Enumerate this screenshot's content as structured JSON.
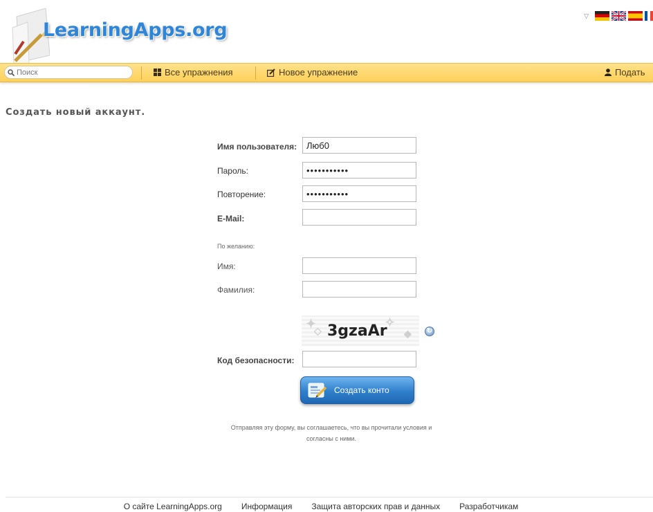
{
  "header": {
    "logo": "LearningApps.org",
    "languages": [
      "de",
      "en",
      "es",
      "fr"
    ]
  },
  "nav": {
    "search_placeholder": "Поиск",
    "all_exercises": "Все упражнения",
    "new_exercise": "Новое упражнение",
    "submit": "Подать"
  },
  "page": {
    "title": "Создать новый аккаунт."
  },
  "form": {
    "username_label": "Имя пользователя:",
    "username_value": "Люб0",
    "password_label": "Пароль:",
    "password_value": "•••••••••••",
    "repeat_label": "Повторение:",
    "repeat_value": "•••••••••••",
    "email_label": "E-Mail:",
    "email_value": "",
    "optional_label": "По желанию:",
    "first_name_label": "Имя:",
    "first_name_value": "",
    "last_name_label": "Фамилия:",
    "last_name_value": "",
    "captcha_text": "3gzaAr",
    "security_code_label": "Код безопасности:",
    "security_code_value": "",
    "submit_button": "Создать конто",
    "agreement": "Отправляя эту форму, вы соглашаетесь, что вы прочитали условия и согласны с ними."
  },
  "footer": {
    "links": [
      "О сайте LearningApps.org",
      "Информация",
      "Защита авторских прав и данных",
      "Разработчикам"
    ]
  },
  "colors": {
    "nav_bg": "#fdd05a",
    "logo_blue": "#2f86d8",
    "button_blue": "#2f7fcb"
  }
}
